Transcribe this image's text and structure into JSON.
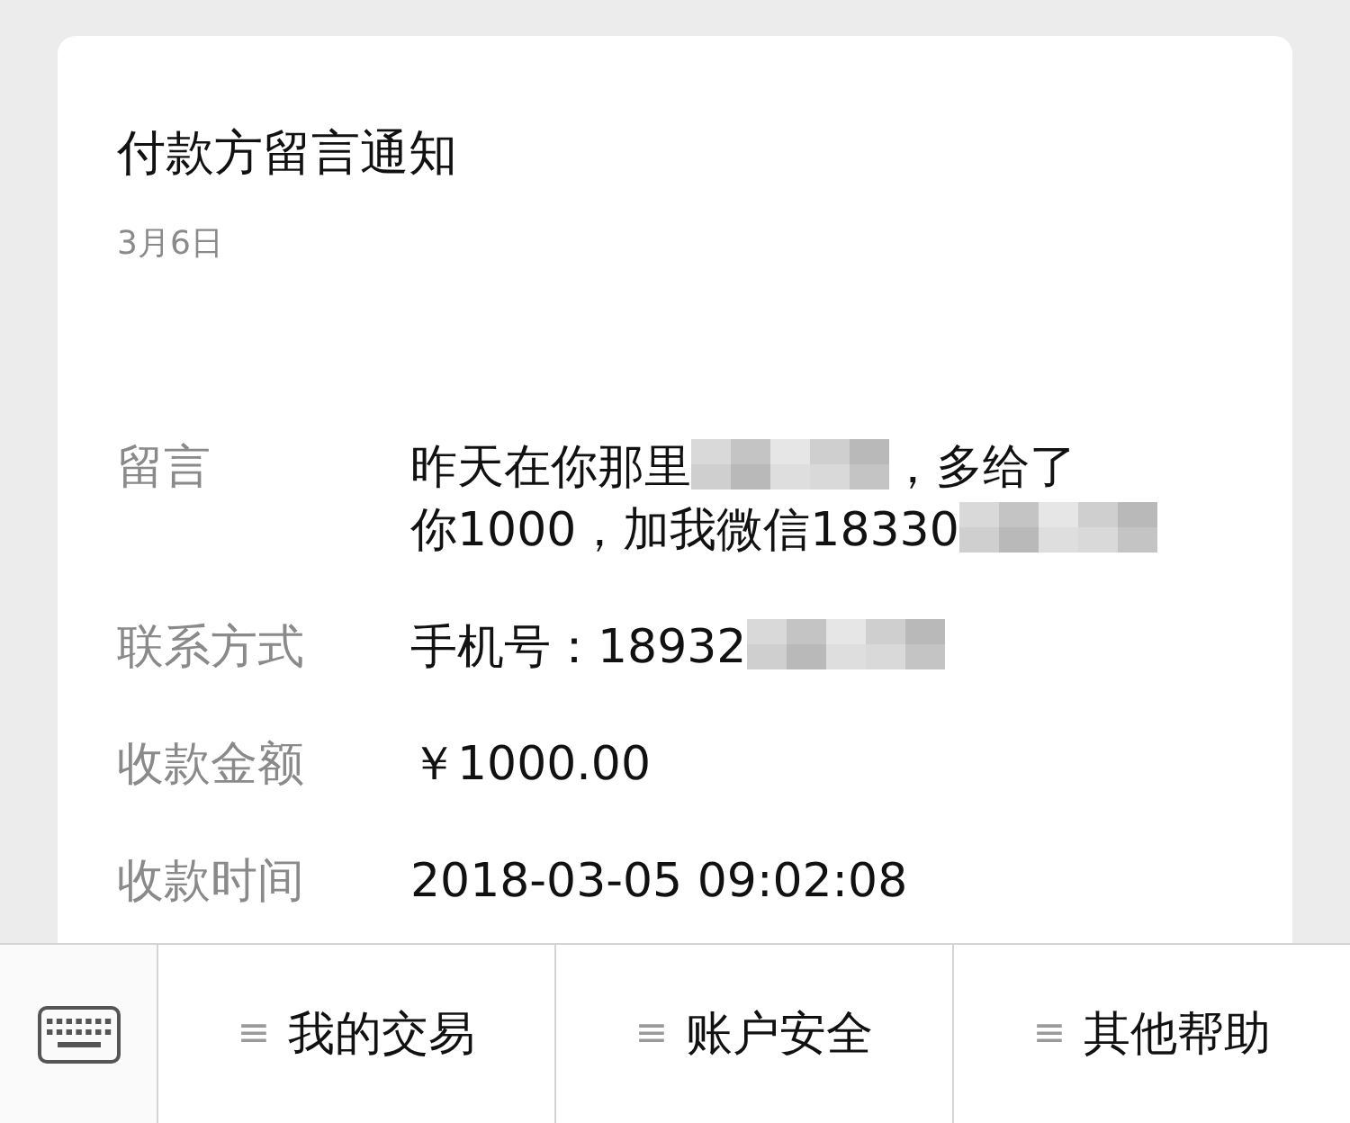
{
  "card": {
    "title": "付款方留言通知",
    "date": "3月6日",
    "rows": [
      {
        "label": "留言",
        "parts": [
          {
            "kind": "text",
            "text": "昨天在你那里"
          },
          {
            "kind": "blur"
          },
          {
            "kind": "text",
            "text": "，多给了"
          },
          {
            "kind": "text",
            "text": "你1000，加我微信18330"
          },
          {
            "kind": "blur"
          }
        ]
      },
      {
        "label": "联系方式",
        "parts": [
          {
            "kind": "text",
            "text": "手机号：18932"
          },
          {
            "kind": "blur"
          }
        ]
      },
      {
        "label": "收款金额",
        "parts": [
          {
            "kind": "text",
            "text": "￥1000.00"
          }
        ]
      },
      {
        "label": "收款时间",
        "parts": [
          {
            "kind": "text",
            "text": "2018-03-05 09:02:08"
          }
        ]
      }
    ]
  },
  "menu_bar": {
    "items": [
      {
        "icon": "≡",
        "label": "我的交易"
      },
      {
        "icon": "≡",
        "label": "账户安全"
      },
      {
        "icon": "≡",
        "label": "其他帮助"
      }
    ]
  }
}
